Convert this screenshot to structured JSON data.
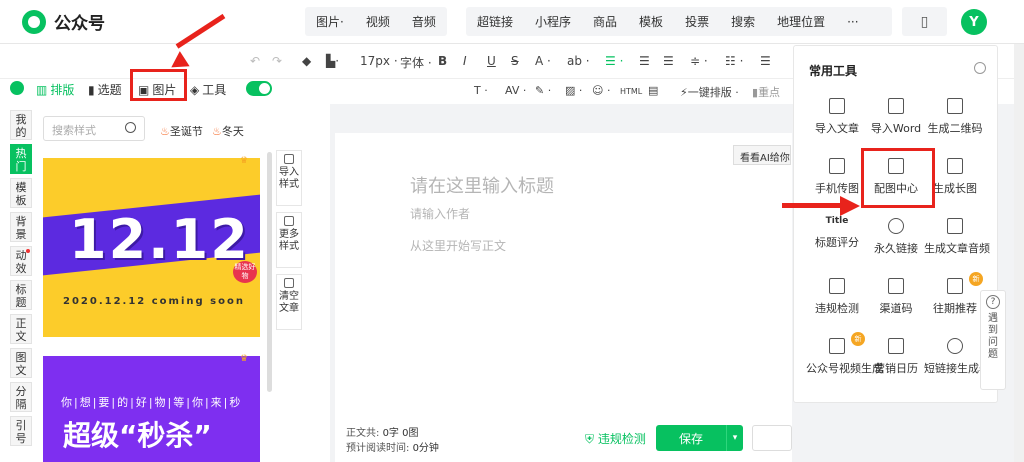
{
  "header": {
    "app_title": "公众号",
    "nav_primary": [
      "图片·",
      "视频",
      "音频"
    ],
    "nav_secondary": [
      "超链接",
      "小程序",
      "商品",
      "模板",
      "投票",
      "搜索",
      "地理位置",
      "···"
    ],
    "avatar_letter": "Y"
  },
  "toolbar": {
    "font_size": "17px",
    "font_family": "字体",
    "one_click_layout": "一键排版",
    "key_point": "重点"
  },
  "panel_tabs": [
    {
      "label": "排版",
      "active": true
    },
    {
      "label": "选题",
      "active": false
    },
    {
      "label": "图片",
      "active": false
    },
    {
      "label": "工具",
      "active": false
    }
  ],
  "vertical_tabs": [
    {
      "label": "我的",
      "active": false,
      "dot": false
    },
    {
      "label": "热门",
      "active": true,
      "dot": false
    },
    {
      "label": "模板",
      "active": false,
      "dot": false
    },
    {
      "label": "背景",
      "active": false,
      "dot": false
    },
    {
      "label": "动效",
      "active": false,
      "dot": true
    },
    {
      "label": "标题",
      "active": false,
      "dot": false
    },
    {
      "label": "正文",
      "active": false,
      "dot": false
    },
    {
      "label": "图文",
      "active": false,
      "dot": false
    },
    {
      "label": "分隔",
      "active": false,
      "dot": false
    },
    {
      "label": "引号",
      "active": false,
      "dot": false
    }
  ],
  "style_search": {
    "placeholder": "搜索样式"
  },
  "hot_tags": [
    "圣诞节",
    "冬天"
  ],
  "template_cards": {
    "card1_big": "12.12",
    "card1_sub": "2020.12.12 coming soon",
    "card1_badge": "精选好物",
    "card2_line1": "你|想|要|的|好|物|等|你|来|秒",
    "card2_line2": "超级“秒杀”"
  },
  "side_actions": [
    "导入样式",
    "更多样式",
    "清空文章"
  ],
  "editor": {
    "title_placeholder": "请在这里输入标题",
    "author_placeholder": "请输入作者",
    "body_placeholder": "从这里开始写正文",
    "ai_hint": "看看AI给你"
  },
  "footer": {
    "word_count_label": "正文共:",
    "word_count_value": "0字 0图",
    "read_time_label": "预计阅读时间:",
    "read_time_value": "0分钟",
    "compliance_check": "违规检测",
    "save_label": "保存"
  },
  "tools_panel": {
    "title": "常用工具",
    "items": [
      {
        "label": "导入文章",
        "new": false
      },
      {
        "label": "导入Word",
        "new": false
      },
      {
        "label": "生成二维码",
        "new": false
      },
      {
        "label": "手机传图",
        "new": false
      },
      {
        "label": "配图中心",
        "new": false
      },
      {
        "label": "生成长图",
        "new": false
      },
      {
        "label": "标题评分",
        "new": false
      },
      {
        "label": "永久链接",
        "new": false
      },
      {
        "label": "生成文章音频",
        "new": false
      },
      {
        "label": "违规检测",
        "new": false
      },
      {
        "label": "渠道码",
        "new": false
      },
      {
        "label": "往期推荐",
        "new": true
      },
      {
        "label": "公众号视频生成",
        "new": true
      },
      {
        "label": "营销日历",
        "new": false
      },
      {
        "label": "短链接生成器",
        "new": false
      }
    ],
    "new_badge": "新",
    "title_score_icon": "Title"
  },
  "help": {
    "label": "遇到问题"
  },
  "colors": {
    "accent": "#07c160",
    "annotation": "#e8231c"
  }
}
